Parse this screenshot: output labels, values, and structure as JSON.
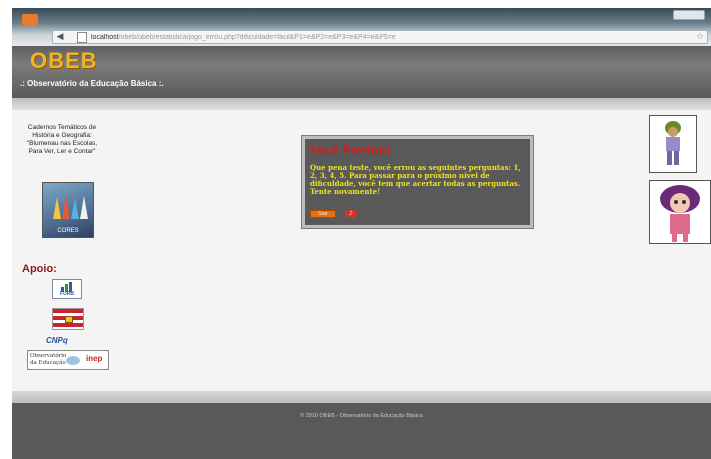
{
  "browser": {
    "url_host": "localhost",
    "url_rest": "/obeb/obeb/estatistica/jogo_errou.php?dificuldade=facil&P1=e&P2=e&P3=e&P4=e&P5=e"
  },
  "header": {
    "logo_text": "OBEB",
    "subtitle": ".: Observatório da Educação Básica :."
  },
  "sidebar": {
    "caption": "Cadernos Temáticos de História e Geografia: \"Blumenau nas Escolas, Para Ver, Ler e Contar\"",
    "book_caption": "CORES",
    "apoio_label": "Apoio:",
    "furb_label": "FURB",
    "cnpq_label": "CNPq",
    "obs_label_line1": "Observatório",
    "obs_label_line2": "da Educação",
    "inep_label": "inep"
  },
  "dialog": {
    "title": "Você Perdeu!",
    "message": "Que pena teste, você errou as seguintes perguntas: 1, 2, 3, 4, 5. Para passar para o próximo nível de dificuldade, você tem que acertar todas as perguntas. Tente novamente!",
    "exit_label": "Sair"
  },
  "footer": {
    "text": "© 2010 OBEB - Observatório da Educação Básica"
  },
  "colors": {
    "logo": "#f0b422",
    "dialog_bg": "#595959",
    "dialog_title": "#d71a1a",
    "dialog_text": "#f0e21e",
    "button": "#e46f14",
    "apoio": "#8a1a1a"
  }
}
